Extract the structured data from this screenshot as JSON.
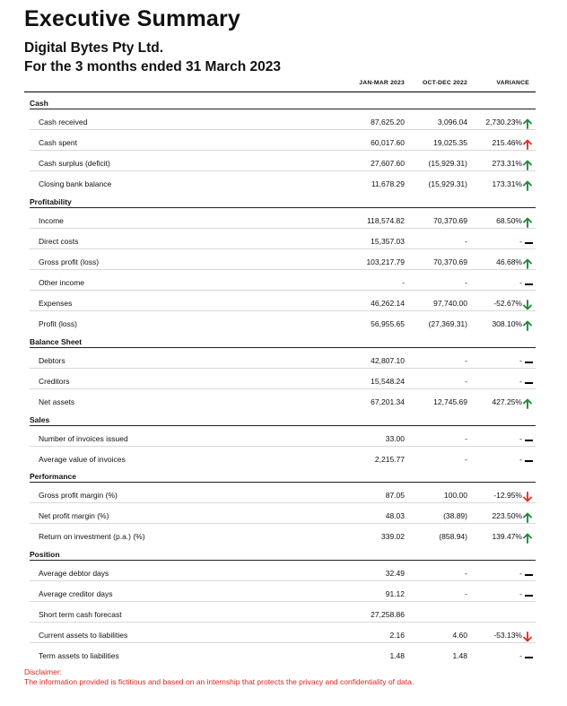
{
  "report": {
    "title": "Executive Summary",
    "organisation": "Digital Bytes Pty Ltd.",
    "period": "For the 3 months ended 31 March 2023"
  },
  "columns": [
    "JAN-MAR 2023",
    "OCT-DEC 2022",
    "VARIANCE"
  ],
  "colors": {
    "up": "#1f8a3c",
    "down": "#e0302a",
    "neutral": "#000000",
    "disclaimer": "#e0231c"
  },
  "sections": [
    {
      "name": "Cash",
      "rows": [
        {
          "label": "Cash received",
          "current": "87,625.20",
          "previous": "3,096.04",
          "variance": "2,730.23%",
          "indicator": "up-green"
        },
        {
          "label": "Cash spent",
          "current": "60,017.60",
          "previous": "19,025.35",
          "variance": "215.46%",
          "indicator": "up-red"
        },
        {
          "label": "Cash surplus (deficit)",
          "current": "27,607.60",
          "previous": "(15,929.31)",
          "variance": "273.31%",
          "indicator": "up-green"
        },
        {
          "label": "Closing bank balance",
          "current": "11,678.29",
          "previous": "(15,929.31)",
          "variance": "173.31%",
          "indicator": "up-green"
        }
      ]
    },
    {
      "name": "Profitability",
      "rows": [
        {
          "label": "Income",
          "current": "118,574.82",
          "previous": "70,370.69",
          "variance": "68.50%",
          "indicator": "up-green"
        },
        {
          "label": "Direct costs",
          "current": "15,357.03",
          "previous": "-",
          "variance": "-",
          "indicator": "neutral"
        },
        {
          "label": "Gross profit (loss)",
          "current": "103,217.79",
          "previous": "70,370.69",
          "variance": "46.68%",
          "indicator": "up-green"
        },
        {
          "label": "Other income",
          "current": "-",
          "previous": "-",
          "variance": "-",
          "indicator": "neutral"
        },
        {
          "label": "Expenses",
          "current": "46,262.14",
          "previous": "97,740.00",
          "variance": "-52.67%",
          "indicator": "down-green"
        },
        {
          "label": "Profit (loss)",
          "current": "56,955.65",
          "previous": "(27,369.31)",
          "variance": "308.10%",
          "indicator": "up-green"
        }
      ]
    },
    {
      "name": "Balance Sheet",
      "rows": [
        {
          "label": "Debtors",
          "current": "42,807.10",
          "previous": "-",
          "variance": "-",
          "indicator": "neutral"
        },
        {
          "label": "Creditors",
          "current": "15,548.24",
          "previous": "-",
          "variance": "-",
          "indicator": "neutral"
        },
        {
          "label": "Net assets",
          "current": "67,201.34",
          "previous": "12,745.69",
          "variance": "427.25%",
          "indicator": "up-green"
        }
      ]
    },
    {
      "name": "Sales",
      "rows": [
        {
          "label": "Number of invoices issued",
          "current": "33.00",
          "previous": "-",
          "variance": "-",
          "indicator": "neutral"
        },
        {
          "label": "Average value of invoices",
          "current": "2,215.77",
          "previous": "-",
          "variance": "-",
          "indicator": "neutral"
        }
      ]
    },
    {
      "name": "Performance",
      "rows": [
        {
          "label": "Gross profit margin (%)",
          "current": "87.05",
          "previous": "100.00",
          "variance": "-12.95%",
          "indicator": "down-red"
        },
        {
          "label": "Net profit margin (%)",
          "current": "48.03",
          "previous": "(38.89)",
          "variance": "223.50%",
          "indicator": "up-green"
        },
        {
          "label": "Return on investment (p.a.) (%)",
          "current": "339.02",
          "previous": "(858.94)",
          "variance": "139.47%",
          "indicator": "up-green"
        }
      ]
    },
    {
      "name": "Position",
      "rows": [
        {
          "label": "Average debtor days",
          "current": "32.49",
          "previous": "-",
          "variance": "-",
          "indicator": "neutral"
        },
        {
          "label": "Average creditor days",
          "current": "91.12",
          "previous": "-",
          "variance": "-",
          "indicator": "neutral"
        },
        {
          "label": "Short term cash forecast",
          "current": "27,258.86",
          "previous": "",
          "variance": "",
          "indicator": "none"
        },
        {
          "label": "Current assets to liabilities",
          "current": "2.16",
          "previous": "4.60",
          "variance": "-53.13%",
          "indicator": "down-red"
        },
        {
          "label": "Term assets to liabilities",
          "current": "1.48",
          "previous": "1.48",
          "variance": "-",
          "indicator": "neutral"
        }
      ]
    }
  ],
  "disclaimer": {
    "heading": "Disclaimer:",
    "text": "The information provided is fictitious and based on an internship that protects the privacy and confidentiality of data."
  }
}
